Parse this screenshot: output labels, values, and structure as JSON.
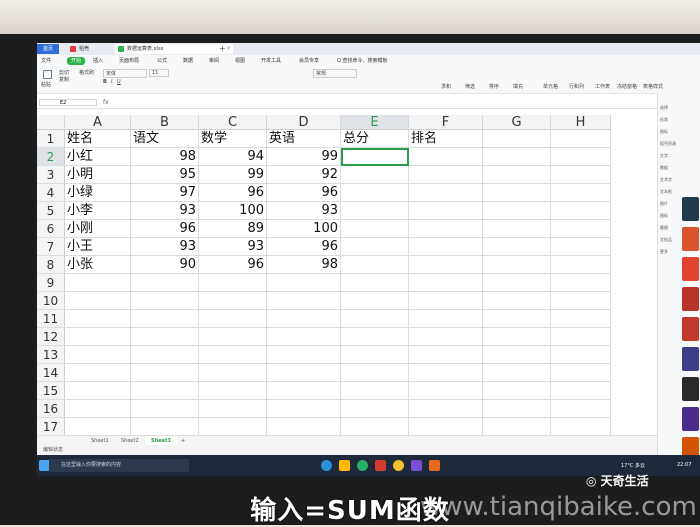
{
  "tabs": {
    "home": "首页",
    "t1": "稻壳",
    "file": "数据运算表.xlsx"
  },
  "menus": [
    "文件",
    "开始",
    "插入",
    "页面布局",
    "公式",
    "数据",
    "审阅",
    "视图",
    "开发工具",
    "会员专享",
    "Q 查找命令、搜索模板"
  ],
  "menu_active_index": 1,
  "ribbon": {
    "paste": "粘贴",
    "cut": "剪切",
    "copy": "复制",
    "format_painter": "格式刷",
    "font": "宋体",
    "font_size": "11",
    "format": "常规",
    "sum": "求和",
    "filter": "筛选",
    "sort": "排序",
    "fill": "填充",
    "cell": "单元格",
    "row_col": "行和列",
    "sheet": "工作表",
    "freeze": "冻结窗格",
    "table_style": "表格样式"
  },
  "formula": {
    "namebox": "E2",
    "fx": "fx"
  },
  "columns": [
    "A",
    "B",
    "C",
    "D",
    "E",
    "F",
    "G",
    "H"
  ],
  "selected_column": "E",
  "rows": [
    "1",
    "2",
    "3",
    "4",
    "5",
    "6",
    "7",
    "8",
    "9",
    "10",
    "11",
    "12",
    "13",
    "14",
    "15",
    "16",
    "17"
  ],
  "selected_row": "2",
  "header_row": [
    "姓名",
    "语文",
    "数学",
    "英语",
    "总分",
    "排名"
  ],
  "table": [
    [
      "小红",
      "98",
      "94",
      "99"
    ],
    [
      "小明",
      "95",
      "99",
      "92"
    ],
    [
      "小绿",
      "97",
      "96",
      "96"
    ],
    [
      "小李",
      "93",
      "100",
      "93"
    ],
    [
      "小刚",
      "96",
      "89",
      "100"
    ],
    [
      "小王",
      "93",
      "93",
      "96"
    ],
    [
      "小张",
      "90",
      "96",
      "98"
    ]
  ],
  "sheets": [
    "Sheet1",
    "Sheet2",
    "Sheet3"
  ],
  "active_sheet_index": 2,
  "status": "编辑状态",
  "taskbar": {
    "search_placeholder": "在这里输入你要搜索的内容",
    "temp": "17°C 多云",
    "time": "22:07"
  },
  "rightpanel": [
    "选择",
    "形状",
    "图标",
    "稻壳资源",
    "文字",
    "数据",
    "艺术字",
    "文本框",
    "图片",
    "图标",
    "截图",
    "文档品",
    "更多"
  ],
  "brand": "天奇生活",
  "subtitle": "输入=SUM函数",
  "watermark": "www.tianqibaike.com",
  "colors": {
    "accent_green": "#2c9c4e",
    "tab_blue": "#2f6fd8",
    "taskbar": "#1e2a3a"
  }
}
